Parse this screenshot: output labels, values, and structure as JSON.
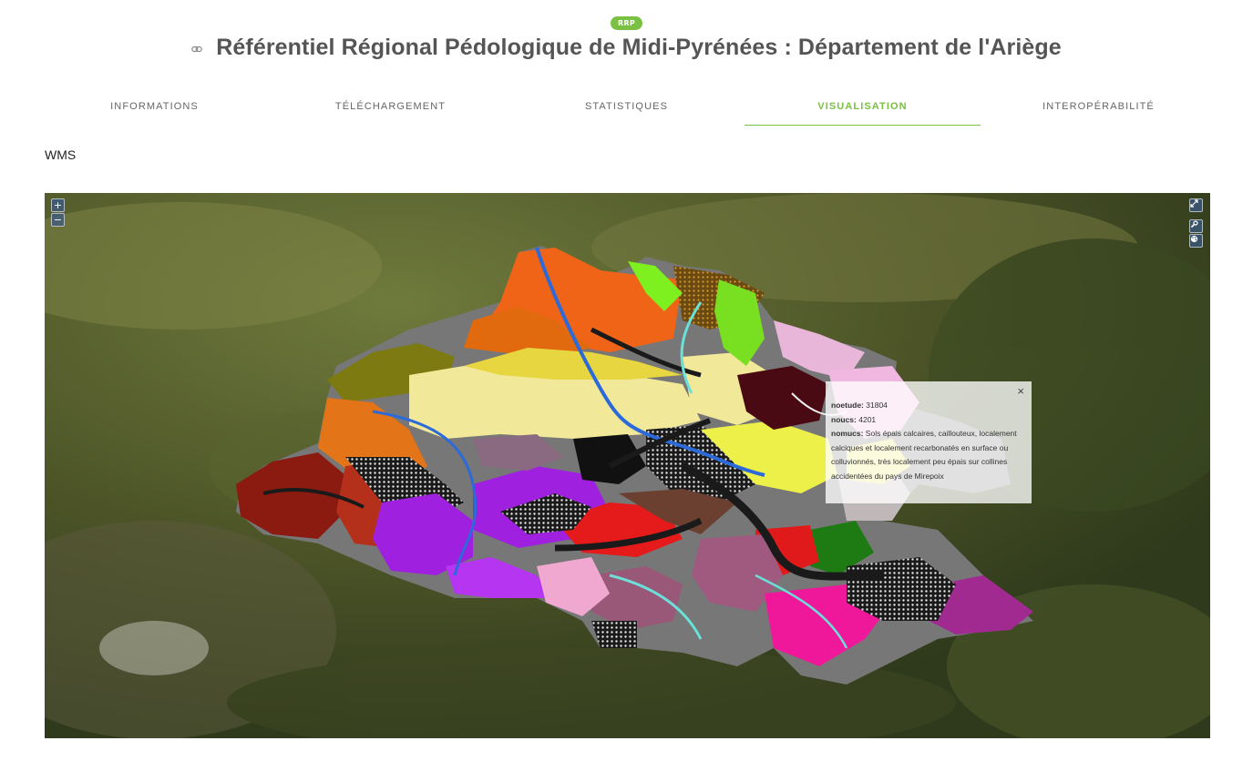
{
  "header": {
    "badge": "RRP",
    "title": "Référentiel Régional Pédologique de Midi-Pyrénées : Département de l'Ariège"
  },
  "tabs": [
    {
      "label": "INFORMATIONS",
      "active": false
    },
    {
      "label": "TÉLÉCHARGEMENT",
      "active": false
    },
    {
      "label": "STATISTIQUES",
      "active": false
    },
    {
      "label": "VISUALISATION",
      "active": true
    },
    {
      "label": "INTEROPÉRABILITÉ",
      "active": false
    }
  ],
  "section": {
    "label": "WMS"
  },
  "map": {
    "zoom_in_label": "+",
    "zoom_out_label": "−",
    "fullscreen_icon": "expand-icon",
    "tools_icon": "wrench-icon",
    "style_icon": "palette-icon",
    "popup": {
      "close_label": "×",
      "fields": [
        {
          "key": "noetude:",
          "value": "31804"
        },
        {
          "key": "noucs:",
          "value": "4201"
        },
        {
          "key": "nomucs:",
          "value": "Sols épais calcaires, caillouteux, localement calciques et localement recarbonatés en surface ou colluvionnés, très localement peu épais sur collines accidentées du pays de Mirepoix"
        }
      ]
    }
  },
  "colors": {
    "accent": "#7ac143",
    "title": "#555555"
  }
}
